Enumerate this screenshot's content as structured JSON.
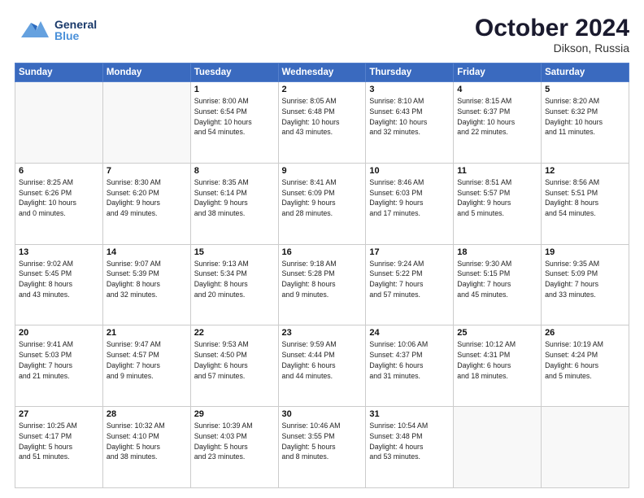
{
  "logo": {
    "general": "General",
    "blue": "Blue"
  },
  "header": {
    "month_year": "October 2024",
    "location": "Dikson, Russia"
  },
  "weekdays": [
    "Sunday",
    "Monday",
    "Tuesday",
    "Wednesday",
    "Thursday",
    "Friday",
    "Saturday"
  ],
  "weeks": [
    [
      {
        "day": "",
        "info": ""
      },
      {
        "day": "",
        "info": ""
      },
      {
        "day": "1",
        "info": "Sunrise: 8:00 AM\nSunset: 6:54 PM\nDaylight: 10 hours\nand 54 minutes."
      },
      {
        "day": "2",
        "info": "Sunrise: 8:05 AM\nSunset: 6:48 PM\nDaylight: 10 hours\nand 43 minutes."
      },
      {
        "day": "3",
        "info": "Sunrise: 8:10 AM\nSunset: 6:43 PM\nDaylight: 10 hours\nand 32 minutes."
      },
      {
        "day": "4",
        "info": "Sunrise: 8:15 AM\nSunset: 6:37 PM\nDaylight: 10 hours\nand 22 minutes."
      },
      {
        "day": "5",
        "info": "Sunrise: 8:20 AM\nSunset: 6:32 PM\nDaylight: 10 hours\nand 11 minutes."
      }
    ],
    [
      {
        "day": "6",
        "info": "Sunrise: 8:25 AM\nSunset: 6:26 PM\nDaylight: 10 hours\nand 0 minutes."
      },
      {
        "day": "7",
        "info": "Sunrise: 8:30 AM\nSunset: 6:20 PM\nDaylight: 9 hours\nand 49 minutes."
      },
      {
        "day": "8",
        "info": "Sunrise: 8:35 AM\nSunset: 6:14 PM\nDaylight: 9 hours\nand 38 minutes."
      },
      {
        "day": "9",
        "info": "Sunrise: 8:41 AM\nSunset: 6:09 PM\nDaylight: 9 hours\nand 28 minutes."
      },
      {
        "day": "10",
        "info": "Sunrise: 8:46 AM\nSunset: 6:03 PM\nDaylight: 9 hours\nand 17 minutes."
      },
      {
        "day": "11",
        "info": "Sunrise: 8:51 AM\nSunset: 5:57 PM\nDaylight: 9 hours\nand 5 minutes."
      },
      {
        "day": "12",
        "info": "Sunrise: 8:56 AM\nSunset: 5:51 PM\nDaylight: 8 hours\nand 54 minutes."
      }
    ],
    [
      {
        "day": "13",
        "info": "Sunrise: 9:02 AM\nSunset: 5:45 PM\nDaylight: 8 hours\nand 43 minutes."
      },
      {
        "day": "14",
        "info": "Sunrise: 9:07 AM\nSunset: 5:39 PM\nDaylight: 8 hours\nand 32 minutes."
      },
      {
        "day": "15",
        "info": "Sunrise: 9:13 AM\nSunset: 5:34 PM\nDaylight: 8 hours\nand 20 minutes."
      },
      {
        "day": "16",
        "info": "Sunrise: 9:18 AM\nSunset: 5:28 PM\nDaylight: 8 hours\nand 9 minutes."
      },
      {
        "day": "17",
        "info": "Sunrise: 9:24 AM\nSunset: 5:22 PM\nDaylight: 7 hours\nand 57 minutes."
      },
      {
        "day": "18",
        "info": "Sunrise: 9:30 AM\nSunset: 5:15 PM\nDaylight: 7 hours\nand 45 minutes."
      },
      {
        "day": "19",
        "info": "Sunrise: 9:35 AM\nSunset: 5:09 PM\nDaylight: 7 hours\nand 33 minutes."
      }
    ],
    [
      {
        "day": "20",
        "info": "Sunrise: 9:41 AM\nSunset: 5:03 PM\nDaylight: 7 hours\nand 21 minutes."
      },
      {
        "day": "21",
        "info": "Sunrise: 9:47 AM\nSunset: 4:57 PM\nDaylight: 7 hours\nand 9 minutes."
      },
      {
        "day": "22",
        "info": "Sunrise: 9:53 AM\nSunset: 4:50 PM\nDaylight: 6 hours\nand 57 minutes."
      },
      {
        "day": "23",
        "info": "Sunrise: 9:59 AM\nSunset: 4:44 PM\nDaylight: 6 hours\nand 44 minutes."
      },
      {
        "day": "24",
        "info": "Sunrise: 10:06 AM\nSunset: 4:37 PM\nDaylight: 6 hours\nand 31 minutes."
      },
      {
        "day": "25",
        "info": "Sunrise: 10:12 AM\nSunset: 4:31 PM\nDaylight: 6 hours\nand 18 minutes."
      },
      {
        "day": "26",
        "info": "Sunrise: 10:19 AM\nSunset: 4:24 PM\nDaylight: 6 hours\nand 5 minutes."
      }
    ],
    [
      {
        "day": "27",
        "info": "Sunrise: 10:25 AM\nSunset: 4:17 PM\nDaylight: 5 hours\nand 51 minutes."
      },
      {
        "day": "28",
        "info": "Sunrise: 10:32 AM\nSunset: 4:10 PM\nDaylight: 5 hours\nand 38 minutes."
      },
      {
        "day": "29",
        "info": "Sunrise: 10:39 AM\nSunset: 4:03 PM\nDaylight: 5 hours\nand 23 minutes."
      },
      {
        "day": "30",
        "info": "Sunrise: 10:46 AM\nSunset: 3:55 PM\nDaylight: 5 hours\nand 8 minutes."
      },
      {
        "day": "31",
        "info": "Sunrise: 10:54 AM\nSunset: 3:48 PM\nDaylight: 4 hours\nand 53 minutes."
      },
      {
        "day": "",
        "info": ""
      },
      {
        "day": "",
        "info": ""
      }
    ]
  ]
}
